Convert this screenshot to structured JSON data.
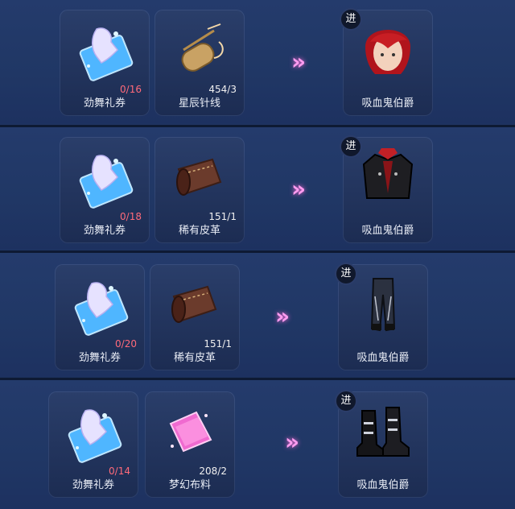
{
  "badge_label": "进",
  "arrow_glyph": "»",
  "colors": {
    "insufficient": "#ff6a7a",
    "arrow": "#ff9cf0"
  },
  "rows": [
    {
      "ticket": {
        "name": "劲舞礼券",
        "count": "0/16"
      },
      "material": {
        "name": "星辰针线",
        "count": "454/3",
        "icon": "needle-thread-icon"
      },
      "result": {
        "name": "吸血鬼伯爵",
        "icon": "red-hair-head-icon"
      }
    },
    {
      "ticket": {
        "name": "劲舞礼券",
        "count": "0/18"
      },
      "material": {
        "name": "稀有皮革",
        "count": "151/1",
        "icon": "leather-roll-icon"
      },
      "result": {
        "name": "吸血鬼伯爵",
        "icon": "jacket-icon"
      }
    },
    {
      "ticket": {
        "name": "劲舞礼券",
        "count": "0/20"
      },
      "material": {
        "name": "稀有皮革",
        "count": "151/1",
        "icon": "leather-roll-icon"
      },
      "result": {
        "name": "吸血鬼伯爵",
        "icon": "pants-icon"
      }
    },
    {
      "ticket": {
        "name": "劲舞礼券",
        "count": "0/14"
      },
      "material": {
        "name": "梦幻布料",
        "count": "208/2",
        "icon": "pink-fabric-icon"
      },
      "result": {
        "name": "吸血鬼伯爵",
        "icon": "boots-icon"
      }
    }
  ]
}
